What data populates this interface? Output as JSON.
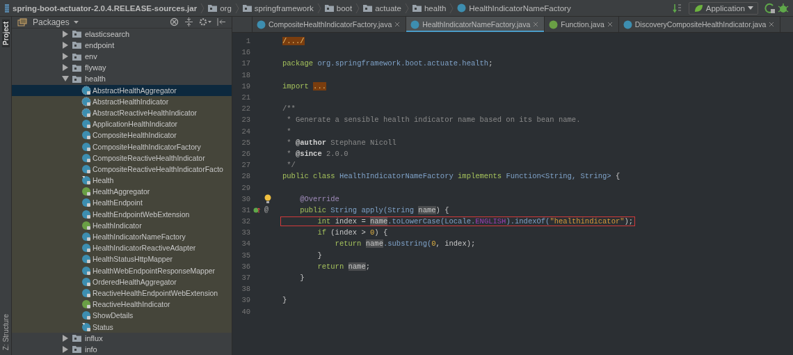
{
  "breadcrumbs": [
    {
      "label": "spring-boot-actuator-2.0.4.RELEASE-sources.jar",
      "kind": "jar"
    },
    {
      "label": "org",
      "kind": "folder"
    },
    {
      "label": "springframework",
      "kind": "folder"
    },
    {
      "label": "boot",
      "kind": "folder"
    },
    {
      "label": "actuate",
      "kind": "folder"
    },
    {
      "label": "health",
      "kind": "folder"
    },
    {
      "label": "HealthIndicatorNameFactory",
      "kind": "class"
    }
  ],
  "run_config": {
    "label": "Application"
  },
  "side_tabs": [
    {
      "label": "Project",
      "selected": true
    },
    {
      "label": "Z: Structure",
      "selected": false
    }
  ],
  "project_panel": {
    "view": "Packages",
    "tree": [
      {
        "label": "elasticsearch",
        "kind": "package",
        "expanded": false
      },
      {
        "label": "endpoint",
        "kind": "package",
        "expanded": false
      },
      {
        "label": "env",
        "kind": "package",
        "expanded": false
      },
      {
        "label": "flyway",
        "kind": "package",
        "expanded": false
      },
      {
        "label": "health",
        "kind": "package",
        "expanded": true,
        "children": [
          {
            "label": "AbstractHealthAggregator",
            "kind": "abstract",
            "selected": true
          },
          {
            "label": "AbstractHealthIndicator",
            "kind": "abstract",
            "selected": false
          },
          {
            "label": "AbstractReactiveHealthIndicator",
            "kind": "abstract",
            "selected": false
          },
          {
            "label": "ApplicationHealthIndicator",
            "kind": "class",
            "selected": false
          },
          {
            "label": "CompositeHealthIndicator",
            "kind": "class",
            "selected": false
          },
          {
            "label": "CompositeHealthIndicatorFactory",
            "kind": "class",
            "selected": false
          },
          {
            "label": "CompositeReactiveHealthIndicator",
            "kind": "class",
            "selected": false
          },
          {
            "label": "CompositeReactiveHealthIndicatorFacto",
            "kind": "class",
            "selected": false
          },
          {
            "label": "Health",
            "kind": "final",
            "selected": false
          },
          {
            "label": "HealthAggregator",
            "kind": "interface",
            "selected": false
          },
          {
            "label": "HealthEndpoint",
            "kind": "class",
            "selected": false
          },
          {
            "label": "HealthEndpointWebExtension",
            "kind": "class",
            "selected": false
          },
          {
            "label": "HealthIndicator",
            "kind": "interface",
            "selected": false
          },
          {
            "label": "HealthIndicatorNameFactory",
            "kind": "class",
            "selected": false
          },
          {
            "label": "HealthIndicatorReactiveAdapter",
            "kind": "class",
            "selected": false
          },
          {
            "label": "HealthStatusHttpMapper",
            "kind": "class",
            "selected": false
          },
          {
            "label": "HealthWebEndpointResponseMapper",
            "kind": "class",
            "selected": false
          },
          {
            "label": "OrderedHealthAggregator",
            "kind": "class",
            "selected": false
          },
          {
            "label": "ReactiveHealthEndpointWebExtension",
            "kind": "class",
            "selected": false
          },
          {
            "label": "ReactiveHealthIndicator",
            "kind": "interface",
            "selected": false
          },
          {
            "label": "ShowDetails",
            "kind": "class",
            "selected": false
          },
          {
            "label": "Status",
            "kind": "final",
            "selected": false
          }
        ]
      },
      {
        "label": "influx",
        "kind": "package",
        "expanded": false
      },
      {
        "label": "info",
        "kind": "package",
        "expanded": false
      }
    ]
  },
  "tabs": [
    {
      "label": "CompositeHealthIndicatorFactory.java",
      "kind": "class",
      "selected": false
    },
    {
      "label": "HealthIndicatorNameFactory.java",
      "kind": "class",
      "selected": true
    },
    {
      "label": "Function.java",
      "kind": "interface",
      "selected": false
    },
    {
      "label": "DiscoveryCompositeHealthIndicator.java",
      "kind": "class",
      "selected": false
    }
  ],
  "editor": {
    "lines": [
      {
        "number": "1",
        "tokens": [
          {
            "text": "/.../",
            "kind": "fold"
          }
        ]
      },
      {
        "number": "16"
      },
      {
        "number": "17",
        "tokens": [
          {
            "text": "package ",
            "kind": "kw"
          },
          {
            "text": "org.springframework.boot.actuate.health",
            "kind": "type"
          },
          {
            "text": ";",
            "kind": "plain"
          }
        ]
      },
      {
        "number": "18"
      },
      {
        "number": "19",
        "tokens": [
          {
            "text": "import ",
            "kind": "kw"
          },
          {
            "text": "...",
            "kind": "fold"
          }
        ]
      },
      {
        "number": "21"
      },
      {
        "number": "22",
        "tokens": [
          {
            "text": "/**",
            "kind": "comment"
          }
        ]
      },
      {
        "number": "23",
        "tokens": [
          {
            "text": " * Generate a sensible health indicator name based on its bean name.",
            "kind": "comment"
          }
        ]
      },
      {
        "number": "24",
        "tokens": [
          {
            "text": " *",
            "kind": "comment"
          }
        ]
      },
      {
        "number": "25",
        "tokens": [
          {
            "text": " * ",
            "kind": "comment"
          },
          {
            "text": "@author",
            "kind": "doctag"
          },
          {
            "text": " Stephane Nicoll",
            "kind": "comment"
          }
        ]
      },
      {
        "number": "26",
        "tokens": [
          {
            "text": " * ",
            "kind": "comment"
          },
          {
            "text": "@since",
            "kind": "doctag"
          },
          {
            "text": " 2.0.0",
            "kind": "comment"
          }
        ]
      },
      {
        "number": "27",
        "tokens": [
          {
            "text": " */",
            "kind": "comment"
          }
        ]
      },
      {
        "number": "28",
        "tokens": [
          {
            "text": "public class ",
            "kind": "kw"
          },
          {
            "text": "HealthIndicatorNameFactory ",
            "kind": "type"
          },
          {
            "text": "implements ",
            "kind": "kw"
          },
          {
            "text": "Function<String, String>",
            "kind": "type"
          },
          {
            "text": " {",
            "kind": "plain"
          }
        ]
      },
      {
        "number": "29"
      },
      {
        "number": "30",
        "bulb": true,
        "tokens": [
          {
            "text": "    @Override",
            "kind": "ann"
          }
        ]
      },
      {
        "number": "31",
        "override": true,
        "gutter_mark": "@",
        "tokens": [
          {
            "text": "    public ",
            "kind": "kw"
          },
          {
            "text": "String apply(String ",
            "kind": "type"
          },
          {
            "text": "name",
            "kind": "hl"
          },
          {
            "text": ") {",
            "kind": "plain"
          }
        ]
      },
      {
        "number": "32",
        "highlighted": true,
        "tokens": [
          {
            "text": "        int ",
            "kind": "kw"
          },
          {
            "text": "index = ",
            "kind": "plain"
          },
          {
            "text": "name",
            "kind": "hl"
          },
          {
            "text": ".toLowerCase(Locale.",
            "kind": "type"
          },
          {
            "text": "ENGLISH",
            "kind": "field"
          },
          {
            "text": ").indexOf(",
            "kind": "type"
          },
          {
            "text": "\"healthindicator\"",
            "kind": "str"
          },
          {
            "text": ");",
            "kind": "plain"
          }
        ]
      },
      {
        "number": "33",
        "tokens": [
          {
            "text": "        if ",
            "kind": "kw"
          },
          {
            "text": "(index > ",
            "kind": "plain"
          },
          {
            "text": "0",
            "kind": "num"
          },
          {
            "text": ") {",
            "kind": "plain"
          }
        ]
      },
      {
        "number": "34",
        "tokens": [
          {
            "text": "            return ",
            "kind": "kw"
          },
          {
            "text": "name",
            "kind": "hl"
          },
          {
            "text": ".substring(",
            "kind": "type"
          },
          {
            "text": "0",
            "kind": "num"
          },
          {
            "text": ", index);",
            "kind": "plain"
          }
        ]
      },
      {
        "number": "35",
        "tokens": [
          {
            "text": "        }",
            "kind": "plain"
          }
        ]
      },
      {
        "number": "36",
        "tokens": [
          {
            "text": "        return ",
            "kind": "kw"
          },
          {
            "text": "name",
            "kind": "hl"
          },
          {
            "text": ";",
            "kind": "plain"
          }
        ]
      },
      {
        "number": "37",
        "tokens": [
          {
            "text": "    }",
            "kind": "plain"
          }
        ]
      },
      {
        "number": "38"
      },
      {
        "number": "39",
        "tokens": [
          {
            "text": "}",
            "kind": "plain"
          }
        ]
      },
      {
        "number": "40"
      }
    ]
  }
}
